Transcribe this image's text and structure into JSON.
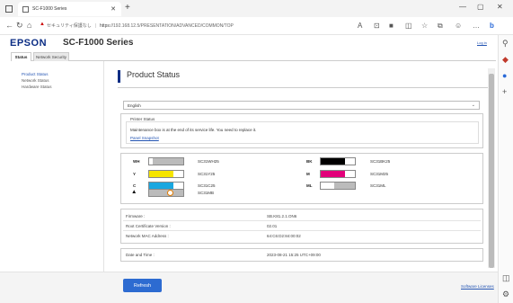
{
  "browser": {
    "tab_title": "SC-F1000 Series",
    "url_warning": "セキュリティ保護なし",
    "url_https": "https",
    "url_rest": "://192.168.12.5/PRESENTATION/ADVANCED/COMMON/TOP"
  },
  "header": {
    "logo": "EPSON",
    "model": "SC-F1000 Series",
    "logout": "Log in"
  },
  "tabs": [
    {
      "label": "Status",
      "active": true
    },
    {
      "label": "Network Security",
      "active": false
    }
  ],
  "sidebar": {
    "items": [
      {
        "label": "Product Status",
        "selected": true
      },
      {
        "label": "Network Status",
        "selected": false
      },
      {
        "label": "Hardware Status",
        "selected": false
      }
    ]
  },
  "main": {
    "title": "Product Status",
    "language": "English",
    "printer_status": {
      "legend": "Printer Status",
      "message": "Maintenance box is at the end of its service life. You need to replace it.",
      "link": "Panel Snapshot"
    },
    "inks": [
      {
        "label": "WH",
        "code": "SC31WH25",
        "color": "#ffffff",
        "level": 0.1
      },
      {
        "label": "Y",
        "code": "SC31Y25",
        "color": "#f6e500",
        "level": 0.7
      },
      {
        "label": "C",
        "code": "SC31C25",
        "color": "#1aa7e0",
        "level": 0.7
      },
      {
        "label": "BK",
        "code": "SC31BK25",
        "color": "#000000",
        "level": 0.7
      },
      {
        "label": "M",
        "code": "SC31M25",
        "color": "#e2007a",
        "level": 0.7
      },
      {
        "label": "ML",
        "code": "SC31ML",
        "color": "#ffffff",
        "level": 0.4
      }
    ],
    "maintenance_box": {
      "code": "SC31MB"
    },
    "info": {
      "rows": [
        {
          "label": "Firmware :",
          "value": "SB.K81.2.1.ON6"
        },
        {
          "label": "Root Certificate Version :",
          "value": "02.01"
        },
        {
          "label": "Network MAC Address :",
          "value": "64:C6:D2:84:00:02"
        }
      ],
      "datetime_label": "Date and Time :",
      "datetime_value": "2023-08-21 15:25 UTC+09:00"
    },
    "refresh_label": "Refresh",
    "software_licenses": "Software Licenses"
  }
}
